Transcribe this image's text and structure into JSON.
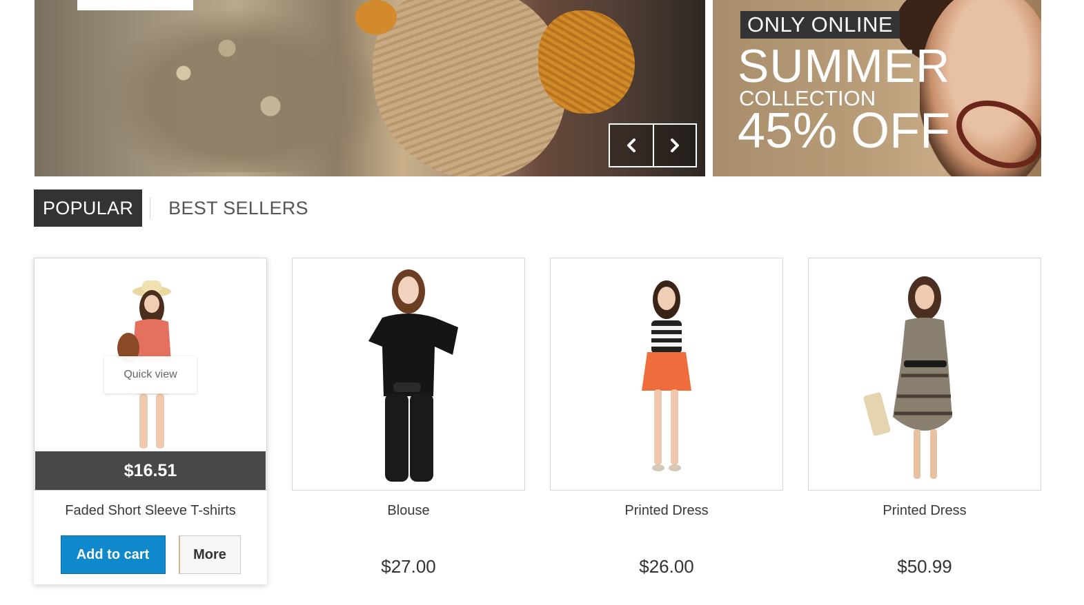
{
  "slider": {
    "prev_icon": "chevron-left-icon",
    "next_icon": "chevron-right-icon"
  },
  "promo": {
    "badge": "ONLY ONLINE",
    "headline": "SUMMER",
    "subline": "COLLECTION",
    "discount": "45% OFF"
  },
  "tabs": {
    "popular": "POPULAR",
    "best_sellers": "BEST SELLERS"
  },
  "products": [
    {
      "name": "Faded Short Sleeve T-shirts",
      "price": "$16.51",
      "quick_view": "Quick view",
      "add_to_cart": "Add to cart",
      "more": "More"
    },
    {
      "name": "Blouse",
      "price": "$27.00"
    },
    {
      "name": "Printed Dress",
      "price": "$26.00"
    },
    {
      "name": "Printed Dress",
      "price": "$50.99"
    }
  ],
  "colors": {
    "dark": "#333333",
    "price_bar": "#484848",
    "accent_blue": "#0f88cc",
    "border": "#d6d4d4"
  }
}
